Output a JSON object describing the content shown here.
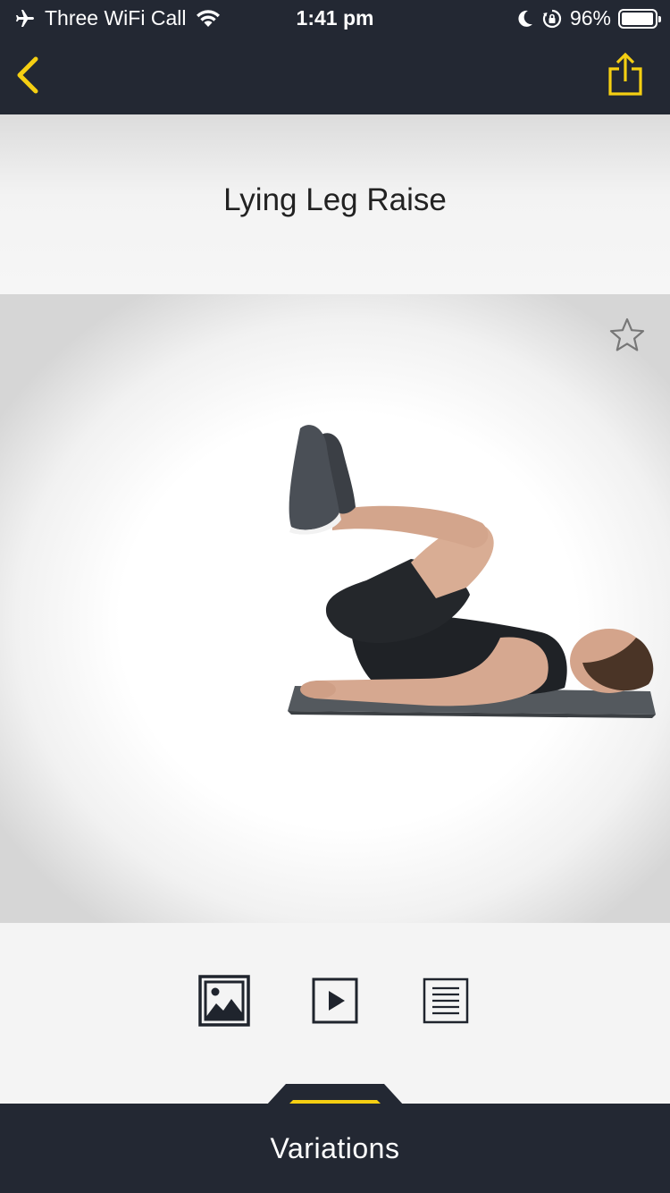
{
  "status_bar": {
    "carrier": "Three WiFi Call",
    "time": "1:41 pm",
    "battery": "96%",
    "battery_level": 0.96,
    "icons": [
      "airplane-icon",
      "wifi-icon",
      "moon-icon",
      "rotation-lock-icon",
      "battery-icon"
    ]
  },
  "nav": {
    "back_icon": "chevron-left-icon",
    "share_icon": "share-icon"
  },
  "exercise": {
    "title": "Lying Leg Raise",
    "favorite_icon": "star-outline-icon",
    "image_alt": "exercise-demonstration-image"
  },
  "media_tabs": [
    {
      "name": "image",
      "icon": "image-icon",
      "selected": true
    },
    {
      "name": "video",
      "icon": "play-icon",
      "selected": false
    },
    {
      "name": "text",
      "icon": "text-lines-icon",
      "selected": false
    }
  ],
  "bottom": {
    "variations_label": "Variations"
  },
  "colors": {
    "bar_background": "#232833",
    "accent_yellow": "#f5cf12",
    "text_dark": "#222222",
    "icon_dark": "#1f242d"
  }
}
